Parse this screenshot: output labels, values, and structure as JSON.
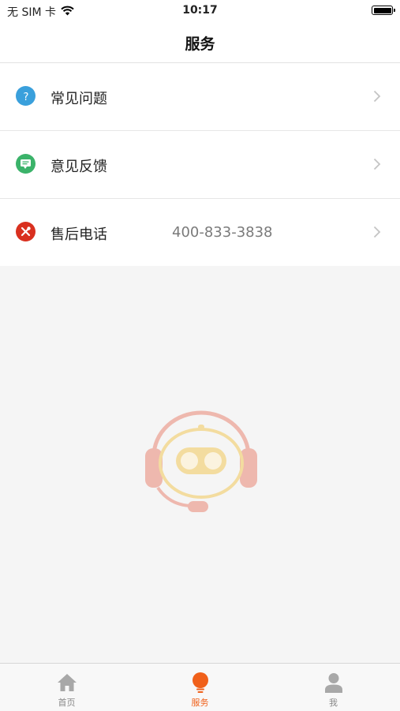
{
  "status_bar": {
    "carrier": "无 SIM 卡",
    "time": "10:17",
    "battery_level": 1.0
  },
  "nav": {
    "title": "服务"
  },
  "menu": [
    {
      "label": "常见问题",
      "value": "",
      "icon": "question-icon",
      "icon_color": "#3aa0dc"
    },
    {
      "label": "意见反馈",
      "value": "",
      "icon": "feedback-icon",
      "icon_color": "#3bb36a"
    },
    {
      "label": "售后电话",
      "value": "400-833-3838",
      "icon": "wrench-icon",
      "icon_color": "#d9301f"
    }
  ],
  "tabs": [
    {
      "label": "首页",
      "icon": "home-icon",
      "active": false
    },
    {
      "label": "服务",
      "icon": "lightbulb-icon",
      "active": true
    },
    {
      "label": "我",
      "icon": "person-icon",
      "active": false
    }
  ],
  "colors": {
    "accent": "#f0601a",
    "inactive": "#a8a8a8",
    "background": "#f5f5f5"
  }
}
